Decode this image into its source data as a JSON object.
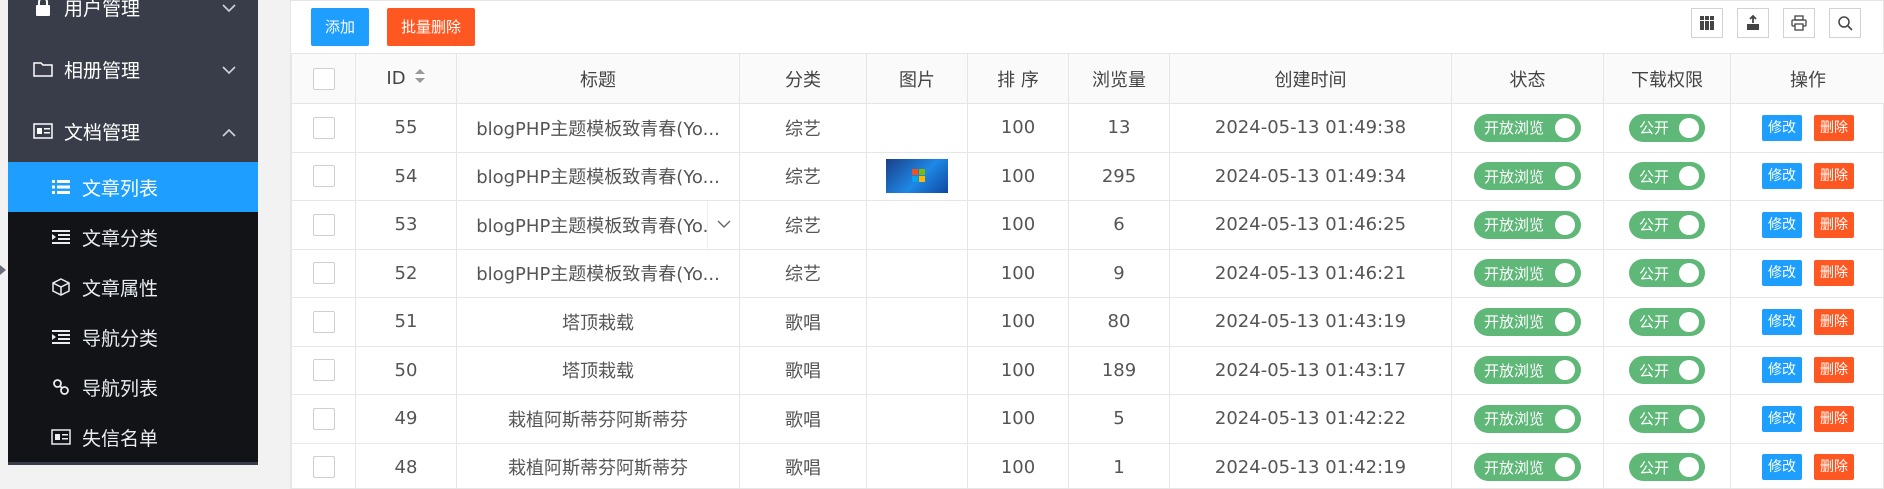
{
  "sidebar": {
    "groups": [
      {
        "label": "用户管理",
        "icon": "user-lock-icon",
        "expanded": false
      },
      {
        "label": "相册管理",
        "icon": "folder-icon",
        "expanded": false
      },
      {
        "label": "文档管理",
        "icon": "id-card-icon",
        "expanded": true
      }
    ],
    "items": [
      {
        "label": "文章列表",
        "icon": "list-icon",
        "active": true
      },
      {
        "label": "文章分类",
        "icon": "indent-icon"
      },
      {
        "label": "文章属性",
        "icon": "cube-icon"
      },
      {
        "label": "导航分类",
        "icon": "indent-icon"
      },
      {
        "label": "导航列表",
        "icon": "link-icon"
      },
      {
        "label": "失信名单",
        "icon": "id-card-icon"
      }
    ]
  },
  "toolbar": {
    "add_label": "添加",
    "batch_delete_label": "批量删除",
    "icons": [
      "columns-icon",
      "export-icon",
      "print-icon",
      "search-icon"
    ]
  },
  "table": {
    "headers": {
      "id": "ID",
      "title": "标题",
      "category": "分类",
      "image": "图片",
      "sort": "排 序",
      "views": "浏览量",
      "created": "创建时间",
      "status": "状态",
      "download": "下载权限",
      "actions": "操作"
    },
    "status_label": "开放浏览",
    "download_label": "公开",
    "edit_label": "修改",
    "delete_label": "删除",
    "rows": [
      {
        "id": "55",
        "title": "blogPHP主题模板致青春(Yo...",
        "category": "综艺",
        "has_image": false,
        "sort": "100",
        "views": "13",
        "created": "2024-05-13 01:49:38"
      },
      {
        "id": "54",
        "title": "blogPHP主题模板致青春(Yo...",
        "category": "综艺",
        "has_image": true,
        "sort": "100",
        "views": "295",
        "created": "2024-05-13 01:49:34"
      },
      {
        "id": "53",
        "title": "blogPHP主题模板致青春(Yo...",
        "category": "综艺",
        "has_image": false,
        "sort": "100",
        "views": "6",
        "created": "2024-05-13 01:46:25",
        "hover_dropdown": true
      },
      {
        "id": "52",
        "title": "blogPHP主题模板致青春(Yo...",
        "category": "综艺",
        "has_image": false,
        "sort": "100",
        "views": "9",
        "created": "2024-05-13 01:46:21"
      },
      {
        "id": "51",
        "title": "塔顶栽载",
        "category": "歌唱",
        "has_image": false,
        "sort": "100",
        "views": "80",
        "created": "2024-05-13 01:43:19"
      },
      {
        "id": "50",
        "title": "塔顶栽载",
        "category": "歌唱",
        "has_image": false,
        "sort": "100",
        "views": "189",
        "created": "2024-05-13 01:43:17"
      },
      {
        "id": "49",
        "title": "栽植阿斯蒂芬阿斯蒂芬",
        "category": "歌唱",
        "has_image": false,
        "sort": "100",
        "views": "5",
        "created": "2024-05-13 01:42:22"
      },
      {
        "id": "48",
        "title": "栽植阿斯蒂芬阿斯蒂芬",
        "category": "歌唱",
        "has_image": false,
        "sort": "100",
        "views": "1",
        "created": "2024-05-13 01:42:19"
      }
    ]
  },
  "colors": {
    "sidebar_bg": "#393d49",
    "sidebar_sub_bg": "#111317",
    "accent_blue": "#1e9fff",
    "danger": "#ff5722",
    "toggle_green": "#5fb878"
  }
}
